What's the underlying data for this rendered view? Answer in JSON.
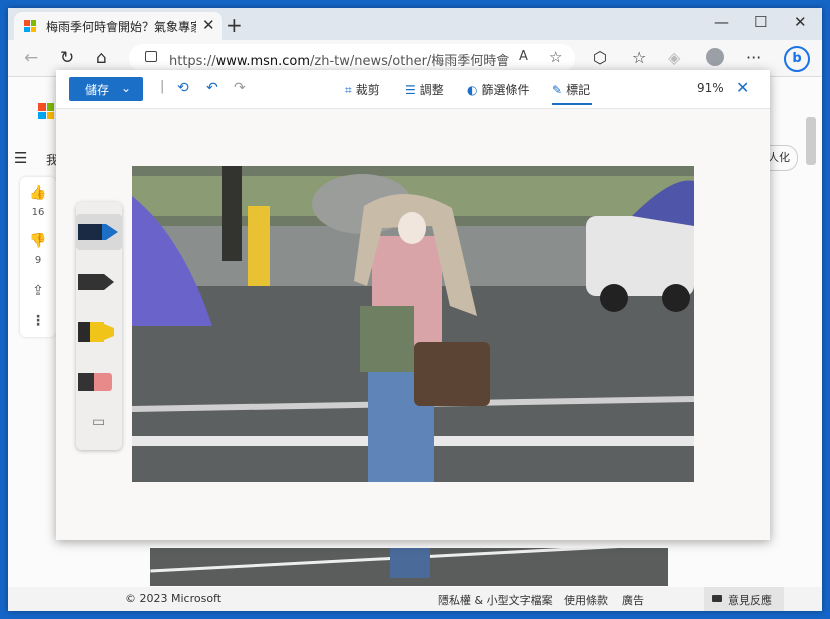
{
  "tab": {
    "title": "梅雨季何時會開始？氣象專家解析",
    "close": "✕"
  },
  "newtab": "+",
  "window_controls": {
    "minimize": "—",
    "maximize": "☐",
    "close": "✕"
  },
  "nav": {
    "back": "←",
    "refresh": "↻",
    "home": "⌂"
  },
  "address": {
    "prefix": "https://",
    "domain": "www.msn.com",
    "path": "/zh-tw/news/other/梅雨季何時會開始-氣..."
  },
  "toolbar_icons": {
    "read_aloud": "A",
    "favorite": "☆",
    "extensions": "⬡",
    "collections": "☆",
    "more": "···",
    "bing": "b"
  },
  "left_bar": {
    "like_count": "16",
    "dislike_count": "9"
  },
  "behind": {
    "snippet_left": "我",
    "snippet_right": "人化"
  },
  "footer": {
    "copyright": "© 2023 Microsoft",
    "privacy": "隱私權 & 小型文字檔案",
    "terms": "使用條款",
    "ads": "廣告",
    "feedback": "意見反應"
  },
  "editor": {
    "save_label": "儲存",
    "save_chevron": "⌄",
    "separator": "|",
    "tools": {
      "crop": "裁剪",
      "adjust": "調整",
      "filter": "篩選條件",
      "markup": "標記"
    },
    "zoom": "91%",
    "close": "✕"
  },
  "colors": {
    "accent": "#1b6fc7",
    "pen_blue": "#1b6fc7",
    "pen_black": "#333333",
    "highlighter": "#f0c419",
    "eraser": "#e98a8a"
  }
}
